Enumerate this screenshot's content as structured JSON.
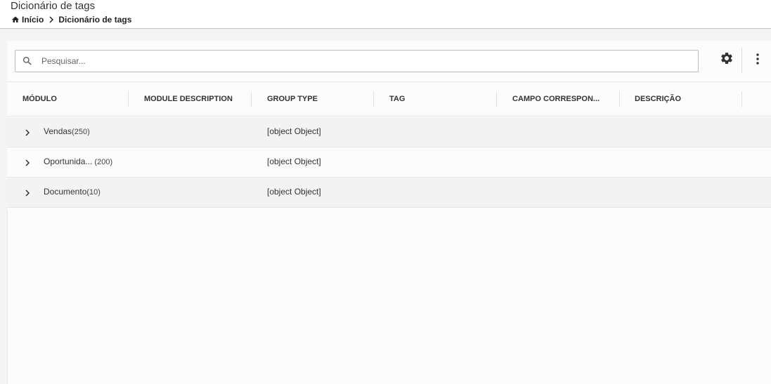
{
  "header": {
    "title": "Dicionário de tags",
    "breadcrumb": {
      "home_label": "Início",
      "current_label": "Dicionário de tags"
    }
  },
  "toolbar": {
    "search_placeholder": "Pesquisar...",
    "search_value": "",
    "icons": [
      "search-icon",
      "gear-icon",
      "more-vertical-icon"
    ]
  },
  "table": {
    "columns": [
      "MÓDULO",
      "MODULE DESCRIPTION",
      "GROUP TYPE",
      "TAG",
      "CAMPO CORRESPON...",
      "DESCRIÇÃO"
    ],
    "rows": [
      {
        "module": "Vendas",
        "count": "(250)",
        "group_type": "[object Object]"
      },
      {
        "module": "Oportunida...",
        "count": " (200)",
        "group_type": "[object Object]"
      },
      {
        "module": "Documento",
        "count": "(10)",
        "group_type": "[object Object]"
      }
    ]
  }
}
